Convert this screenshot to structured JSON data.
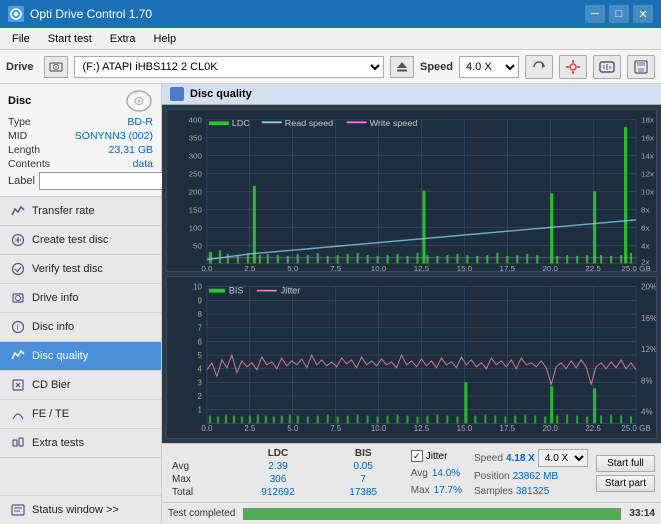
{
  "app": {
    "title": "Opti Drive Control 1.70",
    "icon": "disc-icon"
  },
  "titlebar": {
    "minimize_label": "─",
    "maximize_label": "□",
    "close_label": "✕"
  },
  "menubar": {
    "items": [
      "File",
      "Start test",
      "Extra",
      "Help"
    ]
  },
  "drive_bar": {
    "drive_label": "Drive",
    "drive_value": "(F:) ATAPI iHBS112  2 CL0K",
    "speed_label": "Speed",
    "speed_value": "4.0 X"
  },
  "disc": {
    "title": "Disc",
    "type_label": "Type",
    "type_value": "BD-R",
    "mid_label": "MID",
    "mid_value": "SONYNN3 (002)",
    "length_label": "Length",
    "length_value": "23,31 GB",
    "contents_label": "Contents",
    "contents_value": "data",
    "label_label": "Label",
    "label_value": ""
  },
  "nav": {
    "items": [
      {
        "id": "transfer-rate",
        "label": "Transfer rate",
        "active": false
      },
      {
        "id": "create-test-disc",
        "label": "Create test disc",
        "active": false
      },
      {
        "id": "verify-test-disc",
        "label": "Verify test disc",
        "active": false
      },
      {
        "id": "drive-info",
        "label": "Drive info",
        "active": false
      },
      {
        "id": "disc-info",
        "label": "Disc info",
        "active": false
      },
      {
        "id": "disc-quality",
        "label": "Disc quality",
        "active": true
      },
      {
        "id": "cd-bier",
        "label": "CD Bier",
        "active": false
      },
      {
        "id": "fe-te",
        "label": "FE / TE",
        "active": false
      },
      {
        "id": "extra-tests",
        "label": "Extra tests",
        "active": false
      }
    ],
    "status_window": "Status window >>"
  },
  "disc_quality": {
    "title": "Disc quality",
    "legend": {
      "ldc_label": "LDC",
      "read_speed_label": "Read speed",
      "write_speed_label": "Write speed"
    },
    "legend2": {
      "bis_label": "BIS",
      "jitter_label": "Jitter"
    },
    "chart1": {
      "y_max": 400,
      "y_labels": [
        "400",
        "350",
        "300",
        "250",
        "200",
        "150",
        "100",
        "50",
        "0.0"
      ],
      "y_labels_right": [
        "18x",
        "16x",
        "14x",
        "12x",
        "10x",
        "8x",
        "6x",
        "4x",
        "2x"
      ],
      "x_labels": [
        "0.0",
        "2.5",
        "5.0",
        "7.5",
        "10.0",
        "12.5",
        "15.0",
        "17.5",
        "20.0",
        "22.5",
        "25.0 GB"
      ]
    },
    "chart2": {
      "y_max": 10,
      "y_labels": [
        "10",
        "9",
        "8",
        "7",
        "6",
        "5",
        "4",
        "3",
        "2",
        "1"
      ],
      "y_labels_right": [
        "20%",
        "16%",
        "12%",
        "8%",
        "4%"
      ],
      "x_labels": [
        "0.0",
        "2.5",
        "5.0",
        "7.5",
        "10.0",
        "12.5",
        "15.0",
        "17.5",
        "20.0",
        "22.5",
        "25.0 GB"
      ]
    }
  },
  "stats": {
    "headers": [
      "",
      "LDC",
      "BIS"
    ],
    "avg_label": "Avg",
    "avg_ldc": "2.39",
    "avg_bis": "0.05",
    "max_label": "Max",
    "max_ldc": "306",
    "max_bis": "7",
    "total_label": "Total",
    "total_ldc": "912692",
    "total_bis": "17385",
    "jitter_checked": true,
    "jitter_label": "Jitter",
    "jitter_avg": "14.0%",
    "jitter_max": "17.7%",
    "speed_label": "Speed",
    "speed_value": "4.18 X",
    "speed_dropdown": "4.0 X",
    "position_label": "Position",
    "position_value": "23862 MB",
    "samples_label": "Samples",
    "samples_value": "381325",
    "btn_start_full": "Start full",
    "btn_start_part": "Start part"
  },
  "progress": {
    "status_text": "Test completed",
    "progress_pct": 100,
    "time_text": "33:14"
  },
  "colors": {
    "ldc_color": "#22cc22",
    "read_speed_color": "#88ccee",
    "write_speed_color": "#ff66ff",
    "bis_color": "#22cc22",
    "jitter_color": "#ff88aa",
    "accent": "#0066cc",
    "active_nav": "#4a90d9"
  }
}
